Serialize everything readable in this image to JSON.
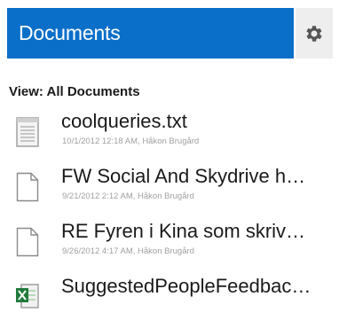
{
  "header": {
    "title": "Documents",
    "settings_icon": "gear-icon"
  },
  "view": {
    "label": "View: All Documents"
  },
  "documents": [
    {
      "name": "coolqueries.txt",
      "meta": "10/1/2012 12:18 AM, Håkon Brugård",
      "icon": "text-file-icon"
    },
    {
      "name": "FW Social And Skydrive h…",
      "meta": "9/21/2012 2:12 AM, Håkon Brugård",
      "icon": "blank-file-icon"
    },
    {
      "name": "RE Fyren i Kina som skriv…",
      "meta": "9/26/2012 4:17 AM, Håkon Brugård",
      "icon": "blank-file-icon"
    },
    {
      "name": "SuggestedPeopleFeedbac…",
      "meta": "",
      "icon": "excel-file-icon"
    }
  ],
  "colors": {
    "header_bg": "#0a6fc9",
    "settings_bg": "#eeeeee"
  }
}
